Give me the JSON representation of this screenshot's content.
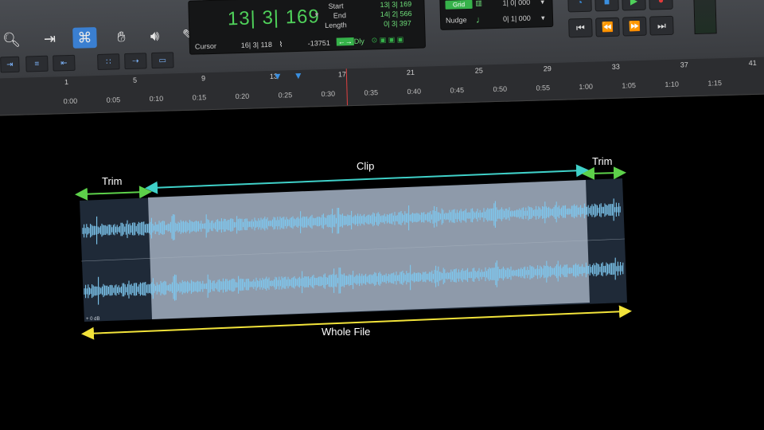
{
  "counter": {
    "main": "13| 3| 169",
    "start_label": "Start",
    "start_value": "13| 3| 169",
    "end_label": "End",
    "end_value": "14| 2| 566",
    "length_label": "Length",
    "length_value": "0| 3| 397",
    "cursor_label": "Cursor",
    "cursor_value": "16| 3| 118",
    "cursor_db": "-13751",
    "dly_label": "Dly"
  },
  "grid": {
    "grid_label": "Grid",
    "grid_value": "1| 0| 000",
    "nudge_label": "Nudge",
    "nudge_value": "0| 1| 000"
  },
  "ruler": {
    "bars": [
      "1",
      "5",
      "9",
      "13",
      "17",
      "21",
      "25",
      "29",
      "33",
      "37",
      "41"
    ],
    "times": [
      "0:00",
      "0:05",
      "0:10",
      "0:15",
      "0:20",
      "0:25",
      "0:30",
      "0:35",
      "0:40",
      "0:45",
      "0:50",
      "0:55",
      "1:00",
      "1:05",
      "1:10",
      "1:15"
    ]
  },
  "clip": {
    "gain_label": "+ 0 dB"
  },
  "annotations": {
    "trim_left": "Trim",
    "clip": "Clip",
    "trim_right": "Trim",
    "whole_file": "Whole File",
    "colors": {
      "trim": "#5dd14a",
      "clip": "#3fd0c8",
      "whole": "#f2e33a",
      "wave": "#7ec8f0"
    }
  }
}
